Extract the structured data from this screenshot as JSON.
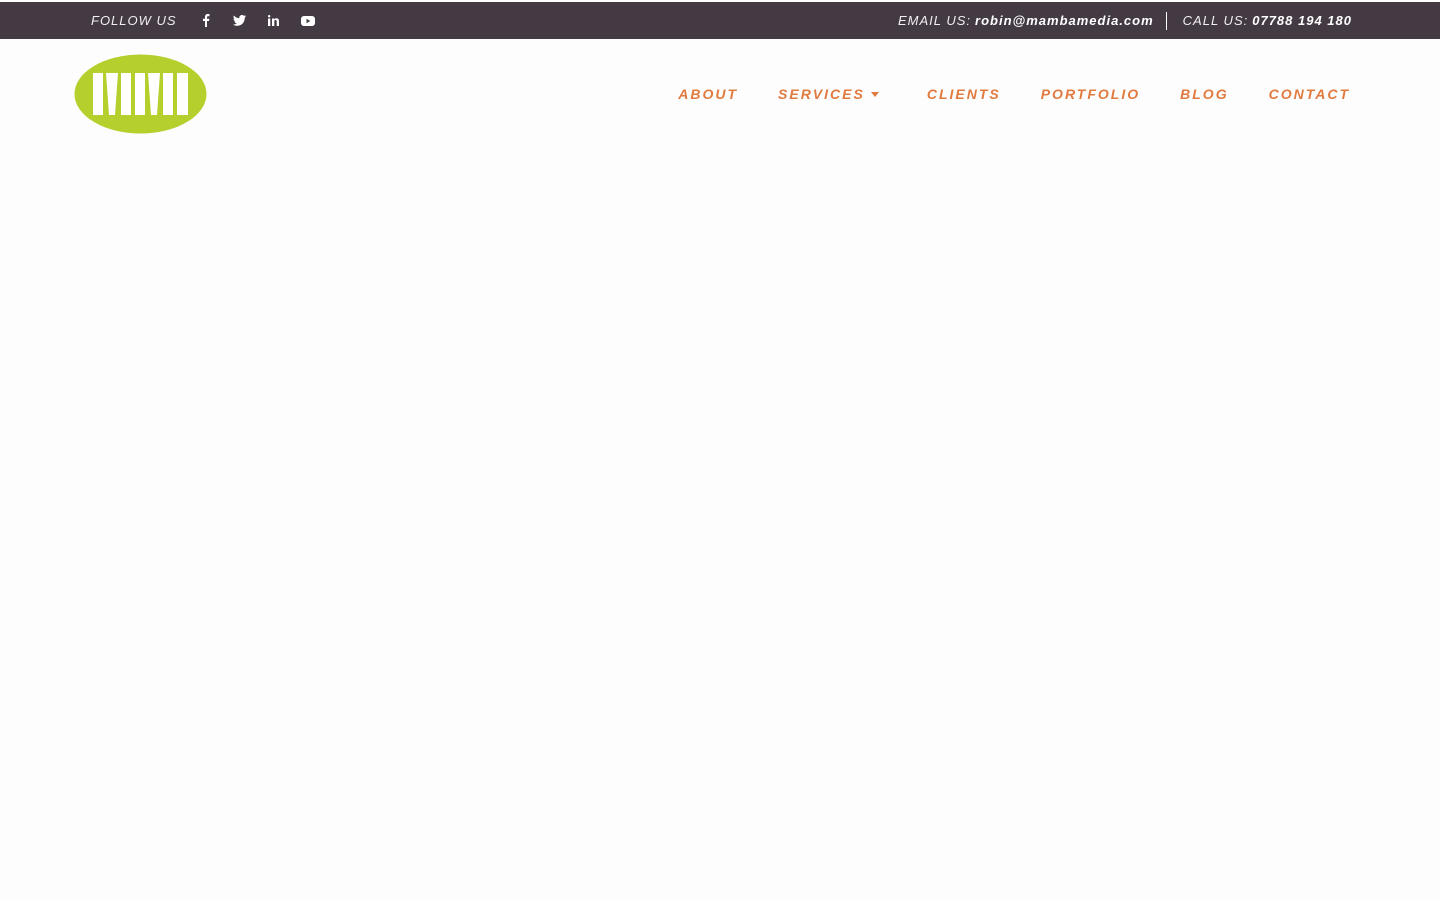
{
  "topbar": {
    "follow_label": "FOLLOW US",
    "social_icons": [
      "facebook-icon",
      "twitter-icon",
      "linkedin-icon",
      "youtube-icon"
    ],
    "email_label": "EMAIL US:",
    "email_value": "robin@mambamedia.com",
    "call_label": "CALL US:",
    "call_value": "07788 194 180"
  },
  "logo": {
    "icon": "mamba-media-logo",
    "color": "#b5cf2d"
  },
  "nav": {
    "items": [
      {
        "label": "ABOUT"
      },
      {
        "label": "SERVICES",
        "has_dropdown": true
      },
      {
        "label": "CLIENTS"
      },
      {
        "label": "PORTFOLIO"
      },
      {
        "label": "BLOG"
      },
      {
        "label": "CONTACT"
      }
    ]
  },
  "colors": {
    "topbar_bg": "#433a44",
    "nav_text": "#e07a3f",
    "logo_green": "#b5cf2d",
    "page_bg": "#fdfdfd"
  }
}
